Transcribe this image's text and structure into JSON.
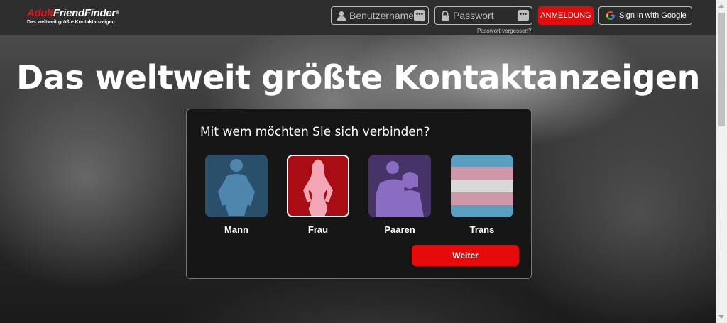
{
  "brand": {
    "name_part1": "Adult",
    "name_part2": "FriendFinder",
    "registered": "®",
    "tagline": "Das weltweit größte Kontaktanzeigen"
  },
  "header": {
    "username_placeholder": "Benutzername",
    "password_placeholder": "Passwort",
    "login_label": "ANMELDUNG",
    "google_label": "Sign in with Google",
    "forgot_label": "Passwort vergessen?",
    "dots": "•••"
  },
  "hero": {
    "title": "Das weltweit größte Kontaktanzeigen"
  },
  "selector": {
    "question": "Mit wem möchten Sie sich verbinden?",
    "options": [
      {
        "label": "Mann",
        "icon": "man-silhouette-icon",
        "color": "#2e5a78",
        "selected": false
      },
      {
        "label": "Frau",
        "icon": "woman-silhouette-icon",
        "color": "#c8101a",
        "selected": true
      },
      {
        "label": "Paaren",
        "icon": "couple-silhouette-icon",
        "color": "#4f3a7a",
        "selected": false
      },
      {
        "label": "Trans",
        "icon": "trans-flag-icon",
        "color": "#5fa8c8",
        "selected": false
      }
    ],
    "next_label": "Weiter"
  },
  "colors": {
    "accent": "#e50b0b",
    "header_bg": "#2e2e2e",
    "card_bg": "#161616"
  }
}
